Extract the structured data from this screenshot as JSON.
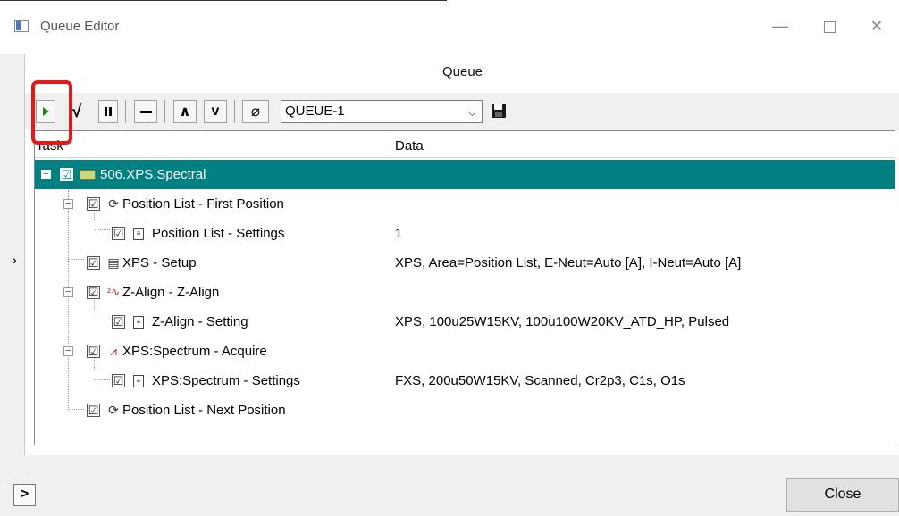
{
  "window": {
    "title": "Queue Editor",
    "min_glyph": "—",
    "close_glyph": "✕"
  },
  "queue_panel": {
    "title": "Queue"
  },
  "toolbar": {
    "check_glyph": "√",
    "up_glyph": "∧",
    "down_glyph": "v",
    "eraser_glyph": "⌀",
    "queue_select_value": "QUEUE-1",
    "dropdown_arrow": "⌵"
  },
  "tree": {
    "columns": {
      "task": "Task",
      "data": "Data"
    },
    "rows": [
      {
        "label": "506.XPS.Spectral",
        "data": "",
        "check": "☑",
        "expander": "−",
        "icon": "folder-icon"
      },
      {
        "label": "Position List - First Position",
        "data": "",
        "check": "☑",
        "expander": "−",
        "icon": "position-first-icon",
        "icon_glyph": "⟳"
      },
      {
        "label": "Position List - Settings",
        "data": "1",
        "check": "☑",
        "icon": "settings-doc-icon"
      },
      {
        "label": "XPS - Setup",
        "data": "XPS, Area=Position List, E-Neut=Auto [A], I-Neut=Auto [A]",
        "check": "☑",
        "icon": "setup-icon",
        "icon_glyph": "▤"
      },
      {
        "label": "Z-Align - Z-Align",
        "data": "",
        "check": "☑",
        "expander": "−",
        "icon": "z-align-icon",
        "icon_glyph": "ᶻ∿"
      },
      {
        "label": "Z-Align - Setting",
        "data": "XPS, 100u25W15KV, 100u100W20KV_ATD_HP, Pulsed",
        "check": "☑",
        "icon": "settings-doc-icon"
      },
      {
        "label": "XPS:Spectrum - Acquire",
        "data": "",
        "check": "☑",
        "expander": "−",
        "icon": "spectrum-icon",
        "icon_glyph": "⩘"
      },
      {
        "label": "XPS:Spectrum - Settings",
        "data": "FXS, 200u50W15KV, Scanned, Cr2p3, C1s, O1s",
        "check": "☑",
        "icon": "settings-doc-icon"
      },
      {
        "label": "Position List - Next Position",
        "data": "",
        "check": "☑",
        "icon": "position-next-icon",
        "icon_glyph": "⟳"
      }
    ]
  },
  "side": {
    "left_arrow": "›",
    "bottom_expander": ">"
  },
  "buttons": {
    "close_label": "Close"
  },
  "colors": {
    "selection": "#008080",
    "highlight": "#e41a1a",
    "play": "#1a8a1a"
  }
}
